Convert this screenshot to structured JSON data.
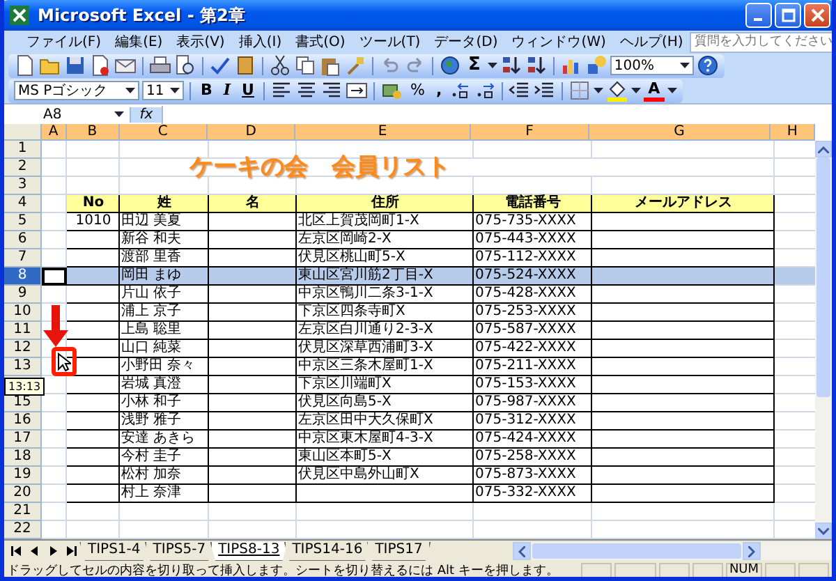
{
  "window": {
    "title": "Microsoft Excel - 第2章"
  },
  "menu": [
    "ファイル(F)",
    "編集(E)",
    "表示(V)",
    "挿入(I)",
    "書式(O)",
    "ツール(T)",
    "データ(D)",
    "ウィンドウ(W)",
    "ヘルプ(H)"
  ],
  "help_search": {
    "placeholder": "質問を入力してください"
  },
  "standard_toolbar": {
    "sum": "Σ",
    "zoom": "100%"
  },
  "format_toolbar": {
    "font": "MS Pゴシック",
    "size": "11",
    "bold": "B",
    "italic": "I",
    "underline": "U",
    "percent": "%",
    "comma": ",",
    "font_color": "A"
  },
  "formula_bar": {
    "name_box": "A8",
    "fx": "fx"
  },
  "sheet": {
    "columns": [
      "A",
      "B",
      "C",
      "D",
      "E",
      "F",
      "G",
      "H"
    ],
    "rows": [
      {
        "header": "1",
        "kind": "blank",
        "selected": false
      },
      {
        "header": "2",
        "kind": "title",
        "selected": false,
        "title": "ケーキの会　会員リスト"
      },
      {
        "header": "3",
        "kind": "blank",
        "selected": false
      },
      {
        "header": "4",
        "kind": "heading",
        "selected": false,
        "cells": {
          "B": "No",
          "C": "姓",
          "D": "名",
          "E": "住所",
          "F": "電話番号",
          "G": "メールアドレス"
        }
      },
      {
        "header": "5",
        "kind": "record",
        "selected": false,
        "cells": {
          "B": "1010",
          "C": "田辺 美夏",
          "E": "北区上賀茂岡町1-X",
          "F": "075-735-XXXX"
        }
      },
      {
        "header": "6",
        "kind": "record",
        "selected": false,
        "cells": {
          "C": "新谷 和夫",
          "E": "左京区岡崎2-X",
          "F": "075-443-XXXX"
        }
      },
      {
        "header": "7",
        "kind": "record",
        "selected": false,
        "cells": {
          "C": "渡部 里香",
          "E": "伏見区桃山町5-X",
          "F": "075-112-XXXX"
        }
      },
      {
        "header": "8",
        "kind": "record",
        "selected": true,
        "cells": {
          "C": "岡田 まゆ",
          "E": "東山区宮川筋2丁目-X",
          "F": "075-524-XXXX"
        }
      },
      {
        "header": "9",
        "kind": "record",
        "selected": false,
        "cells": {
          "C": "片山 依子",
          "E": "中京区鴨川二条3-1-X",
          "F": "075-428-XXXX"
        }
      },
      {
        "header": "10",
        "kind": "record",
        "selected": false,
        "cells": {
          "C": "浦上 京子",
          "E": "下京区四条寺町X",
          "F": "075-253-XXXX"
        }
      },
      {
        "header": "11",
        "kind": "record",
        "selected": false,
        "cells": {
          "C": "上島 聡里",
          "E": "左京区白川通り2-3-X",
          "F": "075-587-XXXX"
        }
      },
      {
        "header": "12",
        "kind": "record",
        "selected": false,
        "cells": {
          "C": "山口 純菜",
          "E": "伏見区深草西浦町3-X",
          "F": "075-422-XXXX"
        }
      },
      {
        "header": "13",
        "kind": "record",
        "selected": false,
        "cells": {
          "C": "小野田 奈々",
          "E": "中京区三条木屋町1-X",
          "F": "075-211-XXXX"
        }
      },
      {
        "kind": "record",
        "selected": false,
        "cells": {
          "C": "岩城 真澄",
          "E": "下京区川端町X",
          "F": "075-153-XXXX"
        }
      },
      {
        "header": "15",
        "kind": "record",
        "selected": false,
        "cells": {
          "C": "小林 和子",
          "E": "伏見区向島5-X",
          "F": "075-987-XXXX"
        }
      },
      {
        "header": "16",
        "kind": "record",
        "selected": false,
        "cells": {
          "C": "浅野 雅子",
          "E": "左京区田中大久保町X",
          "F": "075-312-XXXX"
        }
      },
      {
        "header": "17",
        "kind": "record",
        "selected": false,
        "cells": {
          "C": "安達 あきら",
          "E": "中京区東木屋町4-3-X",
          "F": "075-424-XXXX"
        }
      },
      {
        "header": "18",
        "kind": "record",
        "selected": false,
        "cells": {
          "C": "今村 圭子",
          "E": "東山区本町5-X",
          "F": "075-258-XXXX"
        }
      },
      {
        "header": "19",
        "kind": "record",
        "selected": false,
        "cells": {
          "C": "松村 加奈",
          "E": "伏見区中島外山町X",
          "F": "075-873-XXXX"
        }
      },
      {
        "header": "20",
        "kind": "record",
        "selected": false,
        "cells": {
          "C": "村上 奈津",
          "F": "075-332-XXXX"
        }
      },
      {
        "header": "21",
        "kind": "blank",
        "selected": false
      },
      {
        "header": "22",
        "kind": "blank",
        "selected": false
      }
    ]
  },
  "drag_tooltip": "13:13",
  "sheet_tabs": [
    {
      "label": "TIPS1-4",
      "selected": false
    },
    {
      "label": "TIPS5-7",
      "selected": false
    },
    {
      "label": "TIPS8-13",
      "selected": true
    },
    {
      "label": "TIPS14-16",
      "selected": false
    },
    {
      "label": "TIPS17",
      "selected": false
    }
  ],
  "status_bar": {
    "message": "ドラッグしてセルの内容を切り取って挿入します。シートを切り替えるには Alt キーを押します。",
    "indicator": "NUM"
  }
}
